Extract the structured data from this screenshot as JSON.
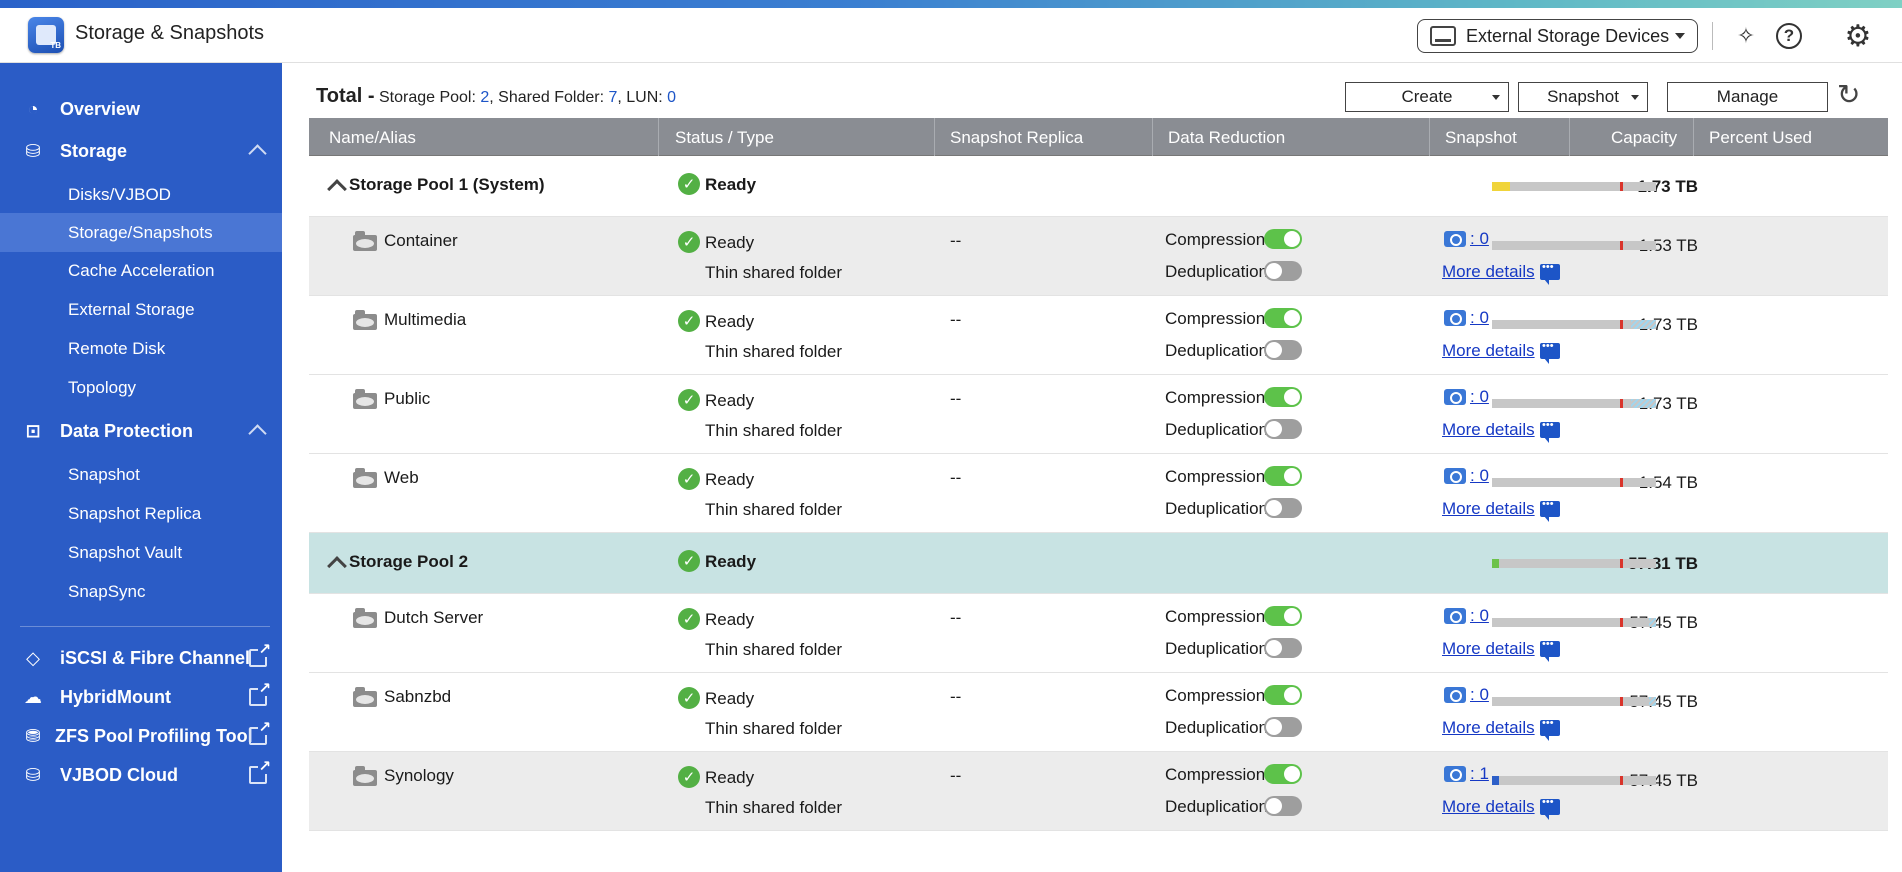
{
  "app": {
    "title": "Storage & Snapshots",
    "icon_badge": "TB"
  },
  "titlebar": {
    "external_devices_label": "External Storage Devices"
  },
  "sidebar": {
    "overview": "Overview",
    "storage": "Storage",
    "storage_items": [
      "Disks/VJBOD",
      "Storage/Snapshots",
      "Cache Acceleration",
      "External Storage",
      "Remote Disk",
      "Topology"
    ],
    "data_protection": "Data Protection",
    "data_protection_items": [
      "Snapshot",
      "Snapshot Replica",
      "Snapshot Vault",
      "SnapSync"
    ],
    "external_apps": [
      "iSCSI & Fibre Channel",
      "HybridMount",
      "ZFS Pool Profiling Tool",
      "VJBOD Cloud"
    ]
  },
  "summary": {
    "total_label": "Total -",
    "pool_label": "Storage Pool:",
    "pool_count": "2",
    "folder_label": ", Shared Folder:",
    "folder_count": "7",
    "lun_label": ", LUN:",
    "lun_count": "0"
  },
  "toolbar": {
    "create": "Create",
    "snapshot": "Snapshot",
    "manage": "Manage"
  },
  "columns": [
    "Name/Alias",
    "Status / Type",
    "Snapshot Replica",
    "Data Reduction",
    "Snapshot",
    "Capacity",
    "Percent Used"
  ],
  "labels": {
    "compression": "Compression:",
    "deduplication": "Deduplication:",
    "more_details": "More details",
    "replica_empty": "--"
  },
  "pools": [
    {
      "name": "Storage Pool 1 (System)",
      "status": "Ready",
      "capacity": "1.73 TB",
      "used_fraction": 0.11,
      "used_color": "#f0d43a",
      "folders": [
        {
          "name": "Container",
          "status": "Ready",
          "type": "Thin shared folder",
          "replica": "--",
          "compression": true,
          "deduplication": false,
          "snapshots": ": 0",
          "capacity": "1.53 TB",
          "used_fraction": 0,
          "hatch_fraction": 0
        },
        {
          "name": "Multimedia",
          "status": "Ready",
          "type": "Thin shared folder",
          "replica": "--",
          "compression": true,
          "deduplication": false,
          "snapshots": ": 0",
          "capacity": "1.73 TB",
          "used_fraction": 0,
          "hatch_fraction": 0.15
        },
        {
          "name": "Public",
          "status": "Ready",
          "type": "Thin shared folder",
          "replica": "--",
          "compression": true,
          "deduplication": false,
          "snapshots": ": 0",
          "capacity": "1.73 TB",
          "used_fraction": 0,
          "hatch_fraction": 0.15
        },
        {
          "name": "Web",
          "status": "Ready",
          "type": "Thin shared folder",
          "replica": "--",
          "compression": true,
          "deduplication": false,
          "snapshots": ": 0",
          "capacity": "1.54 TB",
          "used_fraction": 0,
          "hatch_fraction": 0
        }
      ]
    },
    {
      "name": "Storage Pool 2",
      "status": "Ready",
      "capacity": "57.81 TB",
      "used_fraction": 0.04,
      "used_color": "#6cc24a",
      "folders": [
        {
          "name": "Dutch Server",
          "status": "Ready",
          "type": "Thin shared folder",
          "replica": "--",
          "compression": true,
          "deduplication": false,
          "snapshots": ": 0",
          "capacity": "57.45 TB",
          "used_fraction": 0,
          "hatch_fraction": 0.04
        },
        {
          "name": "Sabnzbd",
          "status": "Ready",
          "type": "Thin shared folder",
          "replica": "--",
          "compression": true,
          "deduplication": false,
          "snapshots": ": 0",
          "capacity": "57.45 TB",
          "used_fraction": 0,
          "hatch_fraction": 0.04
        },
        {
          "name": "Synology",
          "status": "Ready",
          "type": "Thin shared folder",
          "replica": "--",
          "compression": true,
          "deduplication": false,
          "snapshots": ": 1",
          "capacity": "57.45 TB",
          "used_fraction": 0.04,
          "used_color": "#2d5fc8",
          "hatch_fraction": 0
        }
      ]
    }
  ]
}
